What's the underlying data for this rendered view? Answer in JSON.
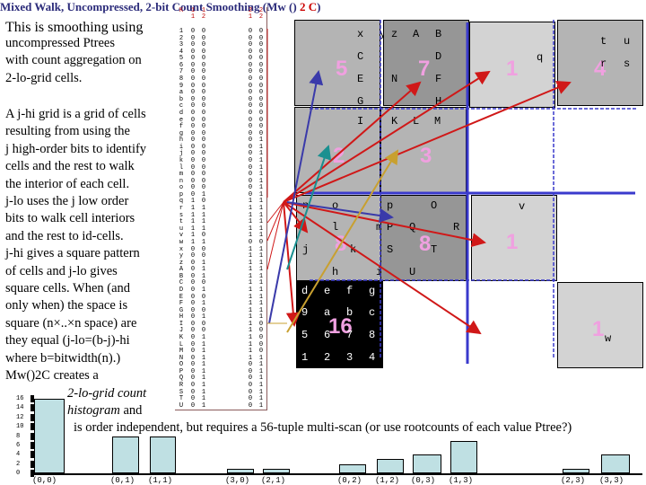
{
  "title": {
    "main": "Mixed Walk, Uncompressed, 2-bit Count Smoothing ",
    "paren_open": "(Mw () ",
    "red": "2 C",
    "paren_close": ")"
  },
  "description": [
    "This is smoothing using",
    "uncompressed Ptrees",
    "with count aggregation on",
    "2-lo-grid cells."
  ],
  "explanation": [
    "A j-hi grid is a grid of cells",
    "resulting from using the",
    "j high-order bits to identify",
    "cells and the rest to walk",
    "the interior of each cell.",
    "j-lo uses the j low order",
    "bits to walk cell interiors",
    "and the rest to id-cells.",
    "j-hi gives a square pattern",
    " of cells and j-lo gives",
    "square cells. When (and",
    "only when) the space is",
    "square (n×..×n space) are",
    "they equal (j-lo=(b-j)-hi",
    "where b=bitwidth(n).)",
    "Mw()2C creates a"
  ],
  "histogram_label_1": "2-lo-grid count",
  "histogram_label_2": "histogram",
  "histogram_label_and": " and",
  "footnote": "is order independent, but requires a 56-tuple multi-scan (or use rootcounts of each value Ptree?)",
  "table": {
    "headers": [
      "K",
      "1 1",
      "1 2",
      "2 1",
      "2 2"
    ],
    "rows": [
      [
        "1",
        "0",
        "0",
        "0",
        "0"
      ],
      [
        "2",
        "0",
        "0",
        "0",
        "0"
      ],
      [
        "3",
        "0",
        "0",
        "0",
        "0"
      ],
      [
        "4",
        "0",
        "0",
        "0",
        "0"
      ],
      [
        "5",
        "0",
        "0",
        "0",
        "0"
      ],
      [
        "6",
        "0",
        "0",
        "0",
        "0"
      ],
      [
        "7",
        "0",
        "0",
        "0",
        "0"
      ],
      [
        "8",
        "0",
        "0",
        "0",
        "0"
      ],
      [
        "9",
        "0",
        "0",
        "0",
        "0"
      ],
      [
        "a",
        "0",
        "0",
        "0",
        "0"
      ],
      [
        "b",
        "0",
        "0",
        "0",
        "0"
      ],
      [
        "c",
        "0",
        "0",
        "0",
        "0"
      ],
      [
        "d",
        "0",
        "0",
        "0",
        "0"
      ],
      [
        "e",
        "0",
        "0",
        "0",
        "0"
      ],
      [
        "f",
        "0",
        "0",
        "0",
        "0"
      ],
      [
        "g",
        "0",
        "0",
        "0",
        "0"
      ],
      [
        "h",
        "0",
        "0",
        "0",
        "1"
      ],
      [
        "i",
        "0",
        "0",
        "0",
        "1"
      ],
      [
        "j",
        "0",
        "0",
        "0",
        "1"
      ],
      [
        "k",
        "0",
        "0",
        "0",
        "1"
      ],
      [
        "l",
        "0",
        "0",
        "0",
        "1"
      ],
      [
        "m",
        "0",
        "0",
        "0",
        "1"
      ],
      [
        "n",
        "0",
        "0",
        "0",
        "1"
      ],
      [
        "o",
        "0",
        "0",
        "0",
        "1"
      ],
      [
        "p",
        "0",
        "1",
        "0",
        "1"
      ],
      [
        "q",
        "1",
        "0",
        "1",
        "1"
      ],
      [
        "r",
        "1",
        "1",
        "1",
        "1"
      ],
      [
        "s",
        "1",
        "1",
        "1",
        "1"
      ],
      [
        "t",
        "1",
        "1",
        "1",
        "1"
      ],
      [
        "u",
        "1",
        "1",
        "1",
        "1"
      ],
      [
        "v",
        "1",
        "0",
        "1",
        "1"
      ],
      [
        "w",
        "1",
        "1",
        "0",
        "0"
      ],
      [
        "x",
        "0",
        "0",
        "1",
        "1"
      ],
      [
        "y",
        "0",
        "0",
        "1",
        "1"
      ],
      [
        "z",
        "0",
        "1",
        "1",
        "1"
      ],
      [
        "A",
        "0",
        "1",
        "1",
        "1"
      ],
      [
        "B",
        "0",
        "1",
        "1",
        "1"
      ],
      [
        "C",
        "0",
        "0",
        "1",
        "1"
      ],
      [
        "D",
        "0",
        "1",
        "1",
        "1"
      ],
      [
        "E",
        "0",
        "0",
        "1",
        "1"
      ],
      [
        "F",
        "0",
        "1",
        "1",
        "1"
      ],
      [
        "G",
        "0",
        "0",
        "1",
        "1"
      ],
      [
        "H",
        "0",
        "1",
        "1",
        "1"
      ],
      [
        "I",
        "0",
        "0",
        "1",
        "0"
      ],
      [
        "J",
        "0",
        "0",
        "1",
        "0"
      ],
      [
        "K",
        "0",
        "1",
        "1",
        "0"
      ],
      [
        "L",
        "0",
        "1",
        "1",
        "0"
      ],
      [
        "M",
        "0",
        "1",
        "1",
        "0"
      ],
      [
        "N",
        "0",
        "1",
        "1",
        "1"
      ],
      [
        "O",
        "0",
        "1",
        "0",
        "1"
      ],
      [
        "P",
        "0",
        "1",
        "0",
        "1"
      ],
      [
        "Q",
        "0",
        "1",
        "0",
        "1"
      ],
      [
        "R",
        "0",
        "1",
        "0",
        "1"
      ],
      [
        "S",
        "0",
        "1",
        "0",
        "1"
      ],
      [
        "T",
        "0",
        "1",
        "0",
        "1"
      ],
      [
        "U",
        "0",
        "1",
        "0",
        "1"
      ]
    ]
  },
  "grid": {
    "counts": [
      "5",
      "7",
      "1",
      "4",
      "2",
      "3",
      "8",
      "8",
      "1",
      "16",
      "1"
    ],
    "letters": {
      "c5": [
        "x",
        "y",
        "C",
        "E",
        "G"
      ],
      "c7": [
        "z",
        "A",
        "B",
        "D",
        "N",
        "F",
        "H"
      ],
      "c1a": [
        "q"
      ],
      "c4": [
        "t",
        "u",
        "r",
        "s"
      ],
      "c2": [
        "I",
        "J"
      ],
      "c3": [
        "K",
        "L",
        "M"
      ],
      "c8a": [
        "n",
        "o",
        "l",
        "m",
        "j",
        "k",
        "h",
        "i"
      ],
      "c8b": [
        "p",
        "O",
        "P",
        "Q",
        "R",
        "S",
        "T",
        "U"
      ],
      "c1b": [
        "v"
      ],
      "c16": [
        "d",
        "e",
        "f",
        "g",
        "9",
        "a",
        "b",
        "c",
        "5",
        "6",
        "7",
        "8",
        "1",
        "2",
        "3",
        "4"
      ],
      "c1c": [
        "w"
      ]
    }
  },
  "chart_data": {
    "type": "bar",
    "categories": [
      "(0,0)",
      "(0,1)",
      "(1,1)",
      "(3,0)",
      "(2,1)",
      "(0,2)",
      "(1,2)",
      "(0,3)",
      "(1,3)",
      "(2,3)",
      "(3,3)"
    ],
    "values": [
      16,
      8,
      8,
      1,
      1,
      2,
      3,
      4,
      7,
      1,
      4
    ],
    "yticks": [
      "0",
      "2",
      "4",
      "6",
      "8",
      "10",
      "12",
      "14",
      "16"
    ],
    "ylim": [
      0,
      16
    ]
  },
  "colors": {
    "title": "#2b2b7a",
    "accent_red": "#cc0000",
    "count_pink": "#f0a0e0",
    "bar": "#bfe0e3",
    "grid_blue": "#3a3acc"
  }
}
